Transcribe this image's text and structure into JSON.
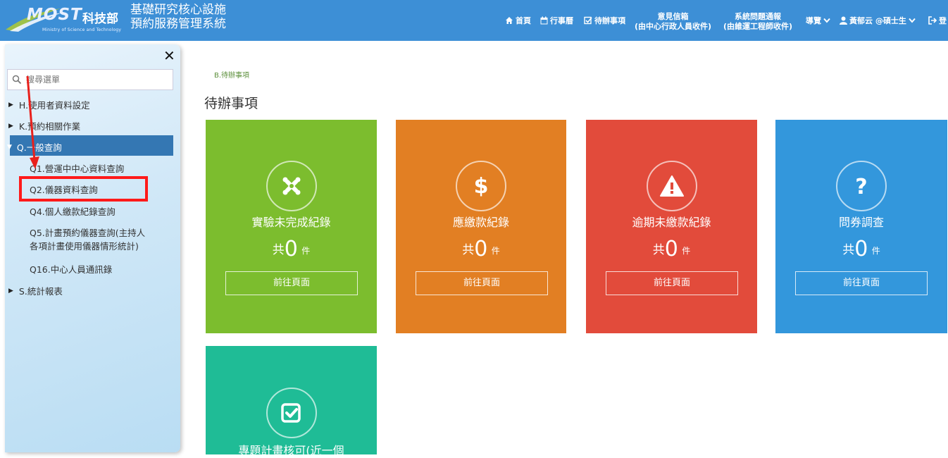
{
  "header": {
    "logo_most": "MOST",
    "logo_zh": "科技部",
    "logo_en": "Ministry of Science and Technology",
    "title_line1": "基礎研究核心設施",
    "title_line2": "預約服務管理系統",
    "nav": {
      "home": "首頁",
      "calendar": "行事曆",
      "todo": "待辦事項",
      "feedback_line1": "意見信箱",
      "feedback_line2": "(由中心行政人員收件)",
      "report_line1": "系統問題通報",
      "report_line2": "(由維運工程師收件)",
      "guide": "導覽",
      "user": "黃郁云 @碩士生",
      "logout": "登"
    }
  },
  "sidebar": {
    "close": "✕",
    "search_placeholder": "搜尋選單",
    "items": {
      "h": "H.使用者資料設定",
      "k": "K.預約相關作業",
      "q": "Q.一般查詢",
      "s": "S.統計報表"
    },
    "sub": {
      "q1": "Q1.營運中中心資料查詢",
      "q2": "Q2.儀器資料查詢",
      "q4": "Q4.個人繳款紀錄查詢",
      "q5_line1": "Q5.計畫預約儀器查詢(主持人",
      "q5_line2": "各項計畫使用儀器情形統計)",
      "q16": "Q16.中心人員通訊錄"
    }
  },
  "main": {
    "breadcrumb": "B.待辦事項",
    "title": "待辦事項",
    "count_prefix": "共",
    "count_suffix": "件",
    "go_label": "前往頁面",
    "cards": [
      {
        "label": "實驗未完成紀錄",
        "count": "0",
        "color": "#7cbd2e",
        "icon": "joomla-icon"
      },
      {
        "label": "應繳款紀錄",
        "count": "0",
        "color": "#e27f23",
        "icon": "dollar-icon"
      },
      {
        "label": "逾期未繳款紀錄",
        "count": "0",
        "color": "#e24b3b",
        "icon": "warning-icon"
      },
      {
        "label": "問券調查",
        "count": "0",
        "color": "#3397dc",
        "icon": "question-icon"
      },
      {
        "label": "專題計畫核可(近一個",
        "count": "",
        "color": "#1fbc96",
        "icon": "check-square-icon"
      }
    ]
  }
}
